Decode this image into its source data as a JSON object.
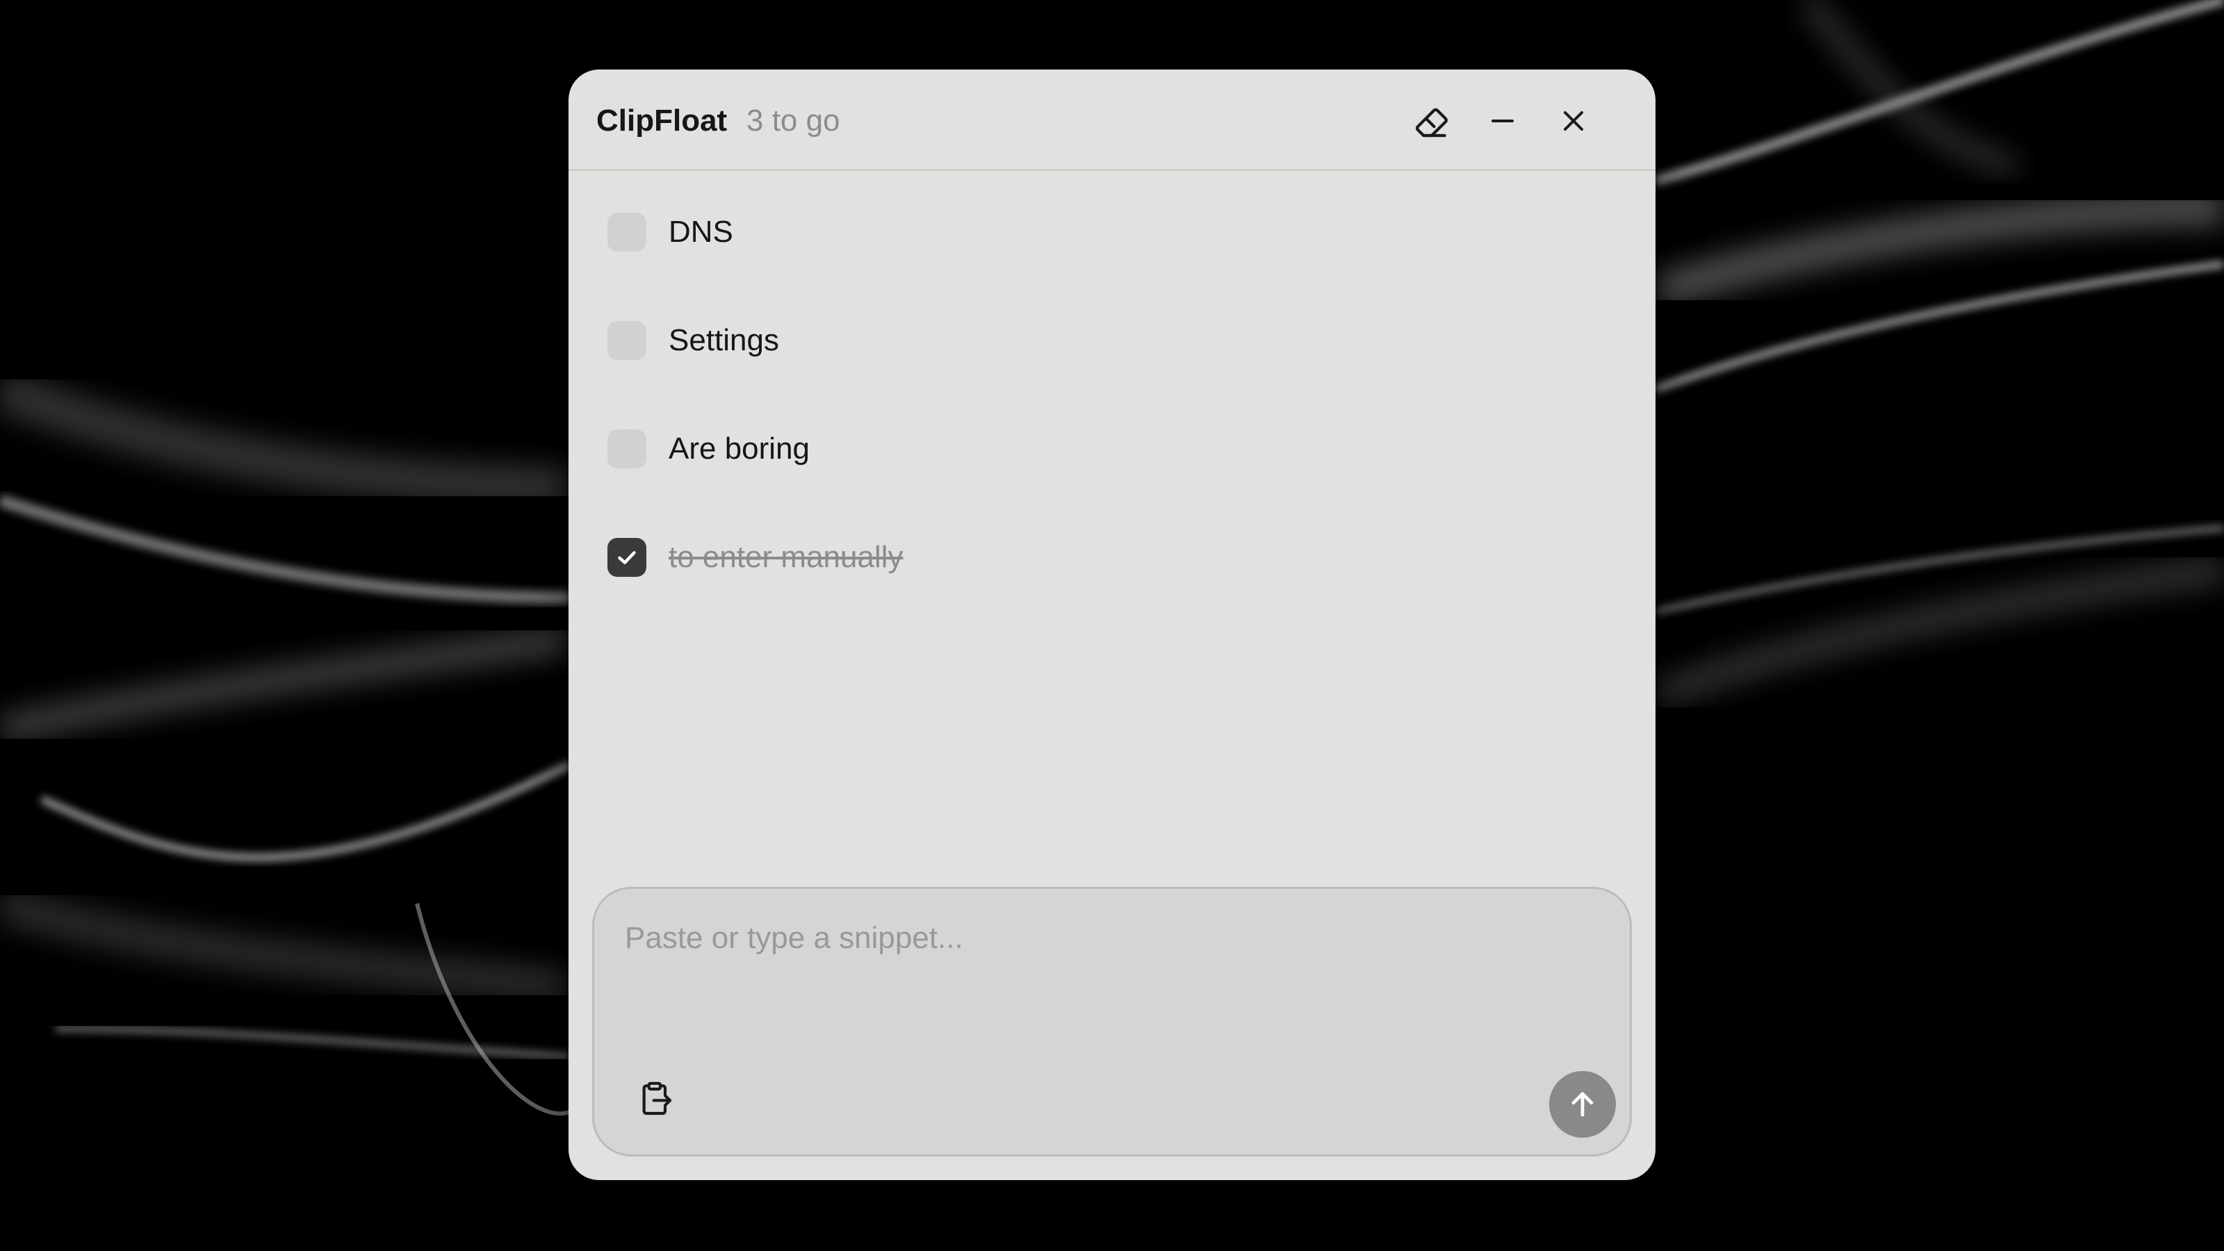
{
  "app": {
    "name": "ClipFloat",
    "remaining": "3 to go"
  },
  "titlebar": {
    "icons": [
      "eraser-icon",
      "minimize-icon",
      "close-icon"
    ]
  },
  "todos": [
    {
      "label": "DNS",
      "checked": false
    },
    {
      "label": "Settings",
      "checked": false
    },
    {
      "label": "Are boring",
      "checked": false
    },
    {
      "label": "to enter manually",
      "checked": true
    }
  ],
  "composer": {
    "value": "",
    "placeholder": "Paste or type a snippet...",
    "icons": [
      "clipboard-paste-icon",
      "arrow-up-icon"
    ]
  },
  "colors": {
    "window_bg": "#e2e1df",
    "checkbox_unchecked": "#d2d1cf",
    "checkbox_checked": "#3a3a3c",
    "muted_text": "#8d8c8a",
    "send_button": "#8a8987"
  }
}
